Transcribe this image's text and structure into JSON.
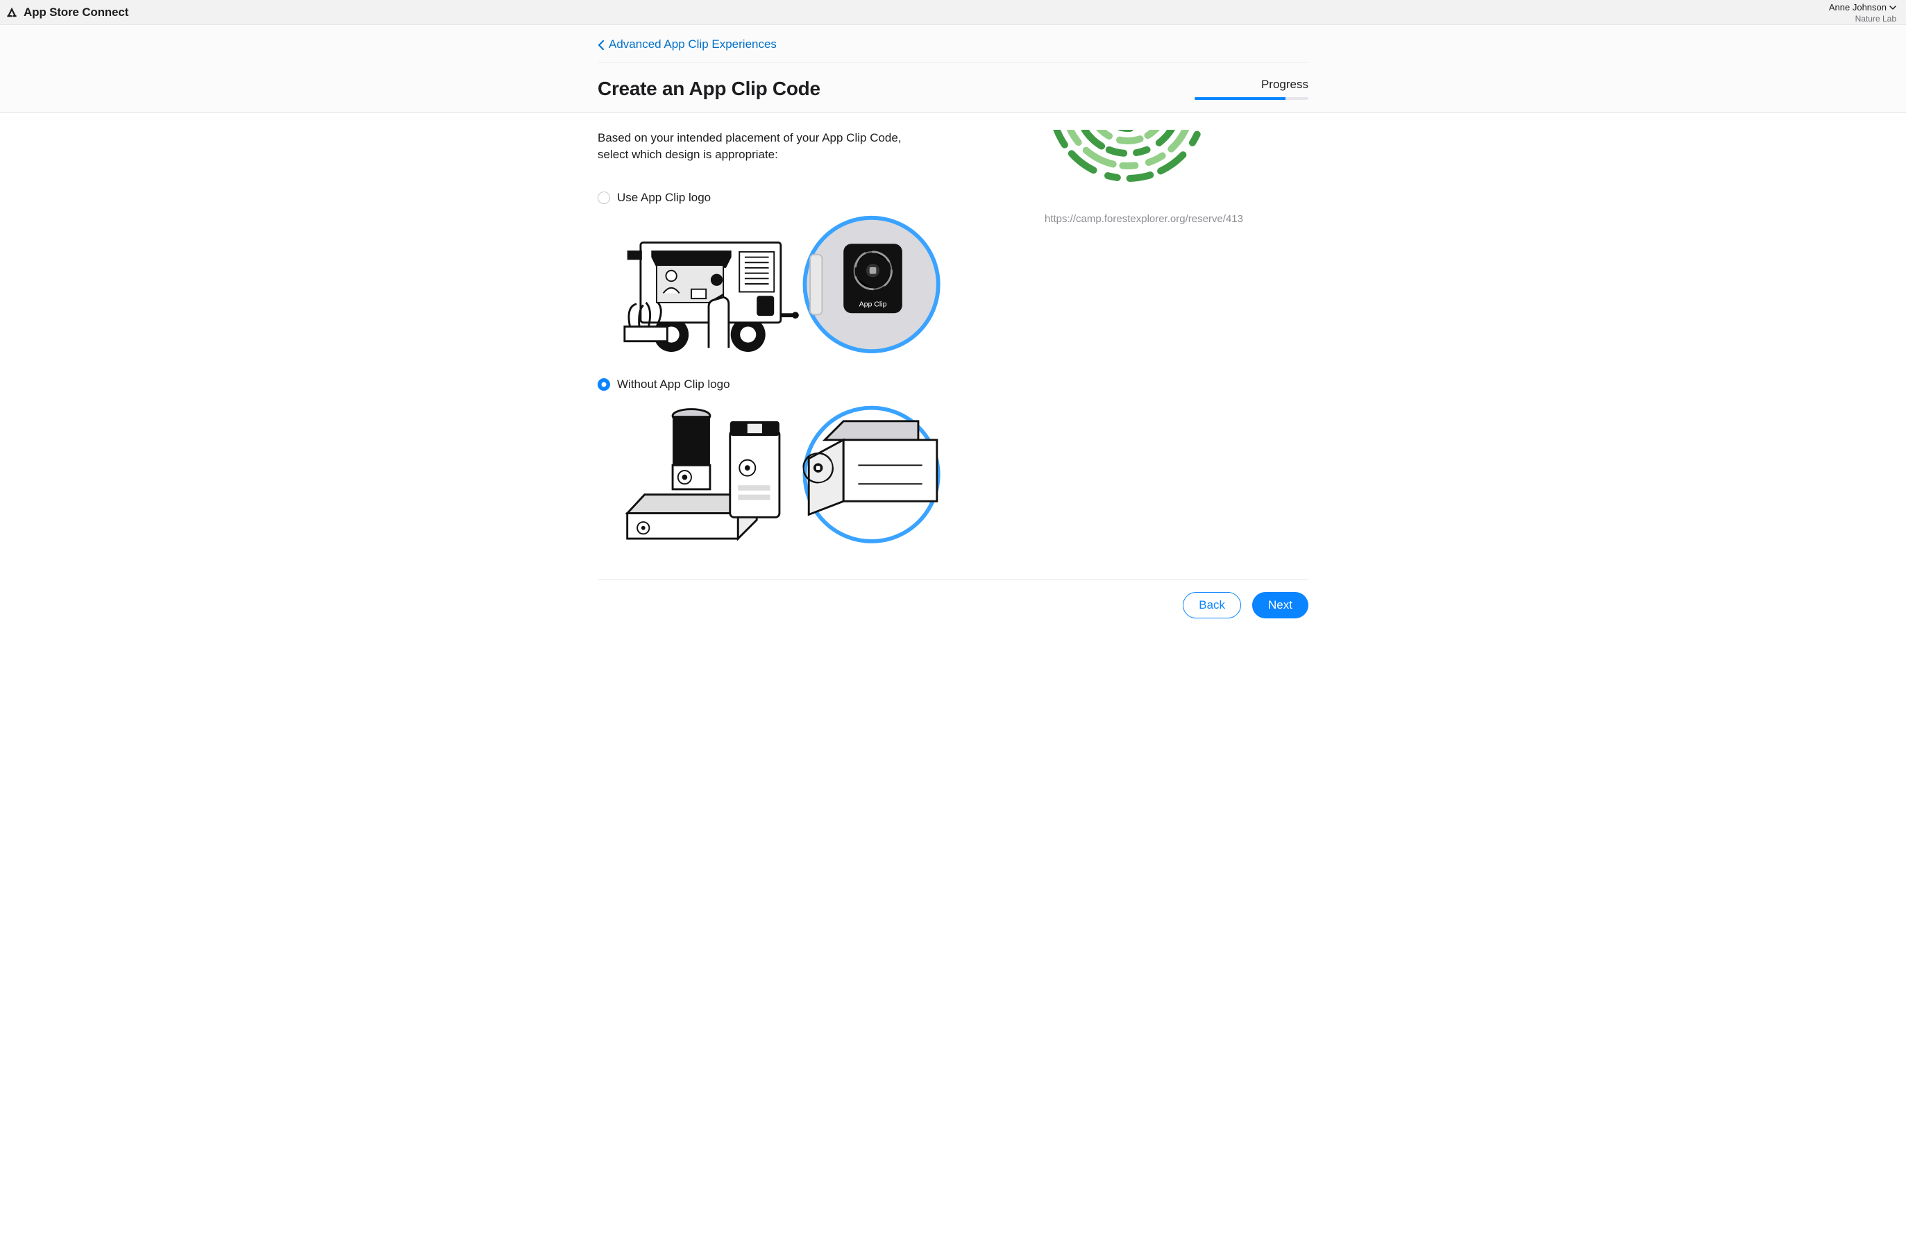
{
  "topbar": {
    "brand": "App Store Connect",
    "user_name": "Anne Johnson",
    "org_name": "Nature Lab"
  },
  "breadcrumb": {
    "label": "Advanced App Clip Experiences"
  },
  "header": {
    "title": "Create an App Clip Code",
    "progress_label": "Progress",
    "progress_pct": 80
  },
  "main": {
    "intro": "Based on your intended placement of your App Clip Code, select which design is appropriate:",
    "options": [
      {
        "id": "with-logo",
        "label": "Use App Clip logo",
        "selected": false
      },
      {
        "id": "without-logo",
        "label": "Without App Clip logo",
        "selected": true
      }
    ],
    "preview_url": "https://camp.forestexplorer.org/reserve/413",
    "code_colors": {
      "dark": "#3f9a44",
      "light": "#93cf88"
    },
    "appclip_badge_text": "App Clip"
  },
  "footer": {
    "back_label": "Back",
    "next_label": "Next"
  }
}
